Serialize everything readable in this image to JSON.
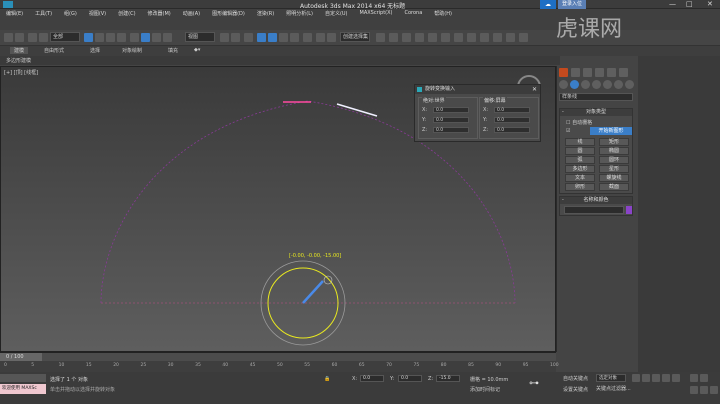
{
  "window": {
    "title": "Autodesk 3ds Max  2014 x64     无标题",
    "cloud_icon": "cloud-icon",
    "login_label": "登录入位",
    "minimize": "—",
    "maximize": "□",
    "close": "✕"
  },
  "menu": {
    "items": [
      "编辑(E)",
      "工具(T)",
      "组(G)",
      "视图(V)",
      "创建(C)",
      "修改器(M)",
      "动画(A)",
      "图形编辑器(D)",
      "渲染(R)",
      "照明分析(L)",
      "自定义(U)",
      "MAXScript(X)",
      "Corona",
      "帮助(H)"
    ]
  },
  "toolbar": {
    "selection_filter": "全部",
    "view_coord": "视图",
    "named_set": "创建选择集"
  },
  "ribbon": {
    "tabs": [
      "建模",
      "自由形式",
      "选择",
      "对象绘制",
      "填充"
    ],
    "active_tab": "建模",
    "sub_label": "多边形建模"
  },
  "viewport": {
    "label": "[+] [顶] [线框]",
    "coord_readout": "[-0.00, -0.00, -15.00]"
  },
  "dialog": {
    "title": "旋转变换输入",
    "close": "✕",
    "absolute_group": "绝对:世界",
    "offset_group": "偏移:屏幕",
    "abs_x": "0.0",
    "abs_y": "0.0",
    "abs_z": "0.0",
    "off_x": "0.0",
    "off_y": "0.0",
    "off_z": "0.0",
    "axis_x": "X:",
    "axis_y": "Y:",
    "axis_z": "Z:"
  },
  "command_panel": {
    "category_dropdown": "样条线",
    "object_type_header": "对象类型",
    "autogrid": "自动栅格",
    "start_new_shape": "开始新图形",
    "buttons": [
      "线",
      "矩形",
      "圆",
      "椭圆",
      "弧",
      "圆环",
      "多边形",
      "星形",
      "文本",
      "螺旋线",
      "卵形",
      "截面"
    ],
    "name_color_header": "名称和颜色",
    "swatch_color": "#8a44c8"
  },
  "timeline": {
    "frame_label": "0 / 100",
    "ticks": [
      "0",
      "5",
      "10",
      "15",
      "20",
      "25",
      "30",
      "35",
      "40",
      "45",
      "50",
      "55",
      "60",
      "65",
      "70",
      "75",
      "80",
      "85",
      "90",
      "95",
      "100"
    ]
  },
  "status": {
    "welcome": "欢迎使用 MAXSc",
    "message1": "选择了 1 个 对象",
    "message2": "单击并拖动以选择并旋转对象",
    "x_label": "X:",
    "y_label": "Y:",
    "z_label": "Z:",
    "x_value": "0.0",
    "y_value": "0.0",
    "z_value": "-15.0",
    "grid": "栅格 = 10.0mm",
    "add_time_tag": "添加时间标记",
    "auto_key": "自动关键点",
    "set_key": "设置关键点",
    "selection_dropdown": "选定对象",
    "key_filters": "关键点过滤器..."
  },
  "watermark": {
    "text": "虎课网"
  }
}
